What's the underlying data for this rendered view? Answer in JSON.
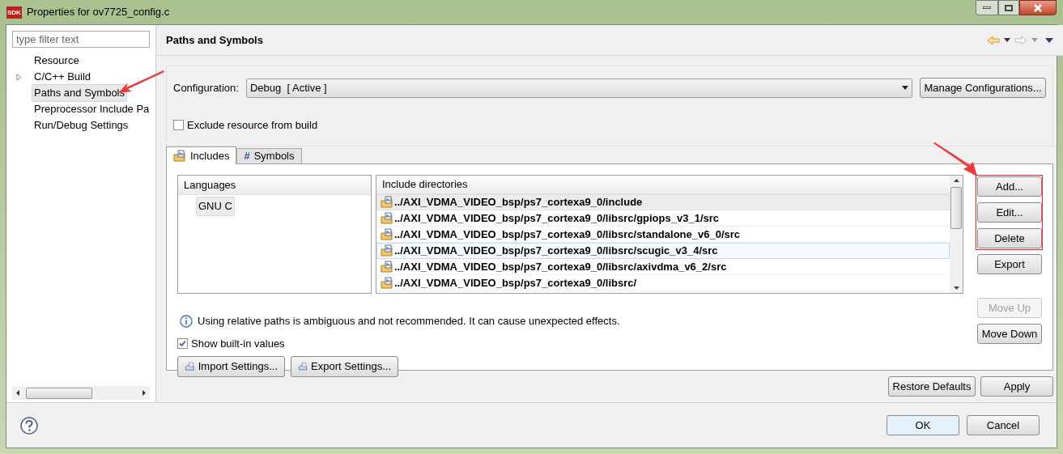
{
  "window": {
    "title": "Properties for ov7725_config.c",
    "app_badge": "SDK"
  },
  "sidebar": {
    "filter": {
      "placeholder": "type filter text"
    },
    "items": [
      {
        "label": "Resource",
        "selected": false,
        "expandable": false
      },
      {
        "label": "C/C++ Build",
        "selected": false,
        "expandable": true
      },
      {
        "label": "Paths and Symbols",
        "selected": true,
        "expandable": false
      },
      {
        "label": "Preprocessor Include Pa",
        "selected": false,
        "expandable": false
      },
      {
        "label": "Run/Debug Settings",
        "selected": false,
        "expandable": false
      }
    ]
  },
  "page": {
    "title": "Paths and Symbols",
    "nav": {
      "back_enabled": true,
      "forward_enabled": false
    }
  },
  "configuration": {
    "label": "Configuration:",
    "value": "Debug  [ Active ]",
    "manage_button": "Manage Configurations..."
  },
  "exclude": {
    "label": "Exclude resource from build",
    "checked": false
  },
  "tabs": [
    {
      "label": "Includes",
      "selected": true,
      "kind": "folder"
    },
    {
      "label": "Symbols",
      "selected": false,
      "kind": "glyph",
      "glyph": "#"
    }
  ],
  "languages": {
    "header": "Languages",
    "items": [
      {
        "label": "GNU C",
        "selected": true
      }
    ]
  },
  "include_directories": {
    "header": "Include directories",
    "rows": [
      {
        "path": "../AXI_VDMA_VIDEO_bsp/ps7_cortexa9_0/include",
        "selected": true,
        "focused": false
      },
      {
        "path": "../AXI_VDMA_VIDEO_bsp/ps7_cortexa9_0/libsrc/gpiops_v3_1/src",
        "selected": false,
        "focused": false
      },
      {
        "path": "../AXI_VDMA_VIDEO_bsp/ps7_cortexa9_0/libsrc/standalone_v6_0/src",
        "selected": false,
        "focused": false
      },
      {
        "path": "../AXI_VDMA_VIDEO_bsp/ps7_cortexa9_0/libsrc/scugic_v3_4/src",
        "selected": false,
        "focused": true
      },
      {
        "path": "../AXI_VDMA_VIDEO_bsp/ps7_cortexa9_0/libsrc/axivdma_v6_2/src",
        "selected": false,
        "focused": false
      },
      {
        "path": "../AXI_VDMA_VIDEO_bsp/ps7_cortexa9_0/libsrc/",
        "selected": false,
        "focused": false
      }
    ]
  },
  "side_buttons": [
    {
      "label": "Add...",
      "disabled": false
    },
    {
      "label": "Edit...",
      "disabled": false
    },
    {
      "label": "Delete",
      "disabled": false
    },
    {
      "label": "Export",
      "disabled": false
    },
    {
      "label": "Move Up",
      "disabled": true
    },
    {
      "label": "Move Down",
      "disabled": false
    }
  ],
  "info": "Using relative paths is ambiguous and not recommended. It can cause unexpected effects.",
  "show_builtin": {
    "label": "Show built-in values",
    "checked": true
  },
  "settings_buttons": [
    "Import Settings...",
    "Export Settings..."
  ],
  "page_buttons": [
    "Restore Defaults",
    "Apply"
  ],
  "dialog_buttons": [
    "OK",
    "Cancel"
  ]
}
